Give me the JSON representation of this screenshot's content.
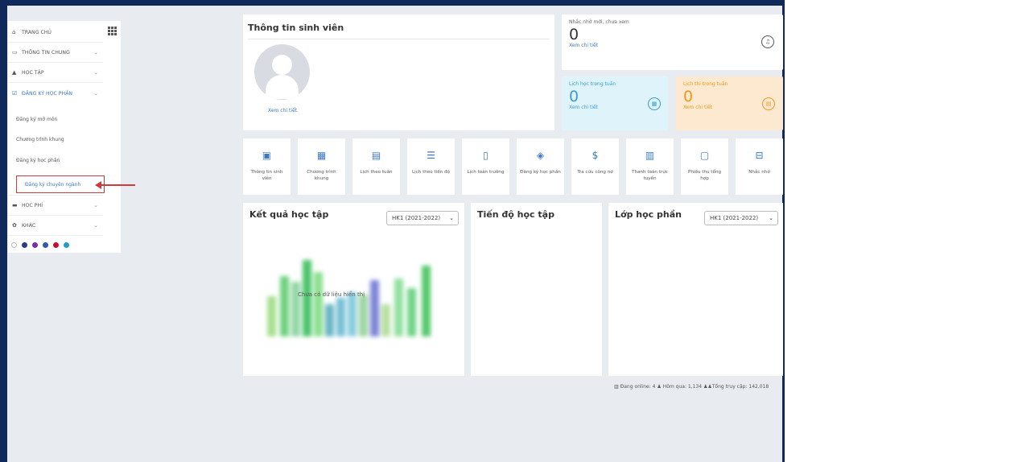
{
  "sidebar": {
    "menu": [
      {
        "label": "TRANG CHỦ",
        "icon": "home-icon"
      },
      {
        "label": "THÔNG TIN CHUNG",
        "icon": "monitor-icon"
      },
      {
        "label": "HỌC TẬP",
        "icon": "graduation-cap-icon"
      },
      {
        "label": "ĐĂNG KÝ HỌC PHẦN",
        "icon": "check-square-icon"
      }
    ],
    "submenu": [
      {
        "label": "Đăng ký mở môn"
      },
      {
        "label": "Chương trình khung"
      },
      {
        "label": "Đăng ký học phần"
      },
      {
        "label": "Đăng ký chuyên ngành"
      }
    ],
    "menu_after": [
      {
        "label": "HỌC PHÍ",
        "icon": "card-icon"
      },
      {
        "label": "KHÁC",
        "icon": "cog-icon"
      }
    ],
    "theme_colors": [
      "#ffffff",
      "#2b3a8c",
      "#7a2fa0",
      "#2f55b5",
      "#c8102e",
      "#1e9fbf"
    ]
  },
  "student_info": {
    "title": "Thông tin sinh viên",
    "detail_link": "Xem chi tiết"
  },
  "stats": {
    "notice": {
      "label": "Nhắc nhở mới, chưa xem",
      "value": "0",
      "link": "Xem chi tiết"
    },
    "week_study": {
      "label": "Lịch học trong tuần",
      "value": "0",
      "link": "Xem chi tiết"
    },
    "week_exam": {
      "label": "Lịch thi trong tuần",
      "value": "0",
      "link": "Xem chi tiết"
    }
  },
  "tiles": [
    {
      "label": "Thông tin sinh viên",
      "icon": "id-card-icon"
    },
    {
      "label": "Chương trình khung",
      "icon": "list-grid-icon"
    },
    {
      "label": "Lịch theo tuần",
      "icon": "calendar-icon"
    },
    {
      "label": "Lịch theo tiến độ",
      "icon": "calendar-list-icon"
    },
    {
      "label": "Lịch toàn trường",
      "icon": "book-open-icon"
    },
    {
      "label": "Đăng ký học phần",
      "icon": "layers-icon"
    },
    {
      "label": "Tra cứu công nợ",
      "icon": "dollar-icon"
    },
    {
      "label": "Thanh toán trực tuyến",
      "icon": "bill-icon"
    },
    {
      "label": "Phiếu thu tổng hợp",
      "icon": "document-icon"
    },
    {
      "label": "Nhắc nhở",
      "icon": "briefcase-icon"
    }
  ],
  "panels": {
    "results": {
      "title": "Kết quả học tập",
      "select_value": "HK1 (2021-2022)",
      "empty_text": "Chưa có dữ liệu hiển thị"
    },
    "progress": {
      "title": "Tiến độ học tập"
    },
    "classes": {
      "title": "Lớp học phần",
      "select_value": "HK1 (2021-2022)"
    }
  },
  "footer": {
    "online": "Đang online: 4",
    "yesterday": "Hôm qua: 1,134",
    "total": "Tổng truy cập: 142,018"
  }
}
